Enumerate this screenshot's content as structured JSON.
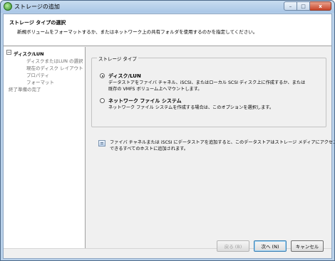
{
  "window": {
    "title": "ストレージの追加",
    "minimize_label": "–",
    "maximize_label": "□",
    "close_label": "x"
  },
  "header": {
    "title": "ストレージ タイプの選択",
    "description": "新規ボリュームをフォーマットするか、またはネットワーク上の共有フォルダを使用するのかを指定してください。"
  },
  "steps": {
    "expander": "−",
    "items": [
      {
        "label": "ディスク/LUN"
      },
      {
        "label": "ディスクまたはLUN の選択"
      },
      {
        "label": "現在のディスク レイアウト"
      },
      {
        "label": "プロパティ"
      },
      {
        "label": "フォーマット"
      },
      {
        "label": "終了準備の完了"
      }
    ]
  },
  "storage_type": {
    "legend": "ストレージ タイプ",
    "options": [
      {
        "label": "ディスク/LUN",
        "checked": true,
        "desc_line1": "データストアをファイバ チャネル、iSCSI、またはローカル SCSI ディスク上に作成するか、または",
        "desc_line2": "既存の VMFS ボリューム上へマウントします。"
      },
      {
        "label": "ネットワーク ファイル システム",
        "checked": false,
        "desc_line1": "ネットワーク ファイル システムを作成する場合は、このオプションを選択します。"
      }
    ]
  },
  "info": {
    "line1": "ファイバ チャネルまたは iSCSI にデータストアを追加すると、このデータストアはストレージ メディアにアクセス",
    "line2": "できるすべてのホストに追加されます。"
  },
  "footer": {
    "back_label": "戻る (B)",
    "next_label": "次へ (N)",
    "cancel_label": "キャンセル"
  }
}
